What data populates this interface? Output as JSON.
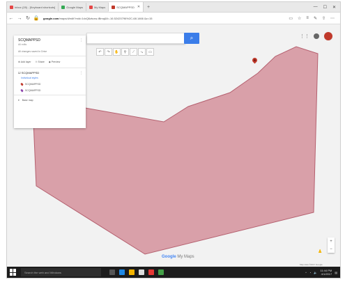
{
  "browser": {
    "tabs": [
      {
        "label": "Inbox (28) - [Keyboard shortcuts]",
        "color": "#e54646",
        "active": false
      },
      {
        "label": "Google Maps",
        "color": "#34a853",
        "active": false
      },
      {
        "label": "My Maps",
        "color": "#e54646",
        "active": false
      },
      {
        "label": "SCQMAPPSD",
        "color": "#c0392b",
        "active": true
      }
    ],
    "url_domain": "google.com",
    "url_rest": "/maps/d/edit?mid=1dxQ6ztuxw-tBmq&ll=-16.52420796%2C-68.1466 &z=15"
  },
  "map": {
    "polygon_color": "#d9a0a9",
    "polygon_stroke": "#b5606f",
    "accent": "#3b7de9",
    "search_placeholder": "",
    "logo_g": "Google",
    "logo_rest": " My Maps",
    "attribution": "Map data ©2017 Google",
    "zoom_in": "+",
    "zoom_out": "−"
  },
  "panel": {
    "title": "SCQMAPPSD",
    "subtitle": "All edits",
    "note": "All changes saved in Drive",
    "actions": [
      "Add layer",
      "Share",
      "Preview"
    ],
    "layer_title": "SCQMAPPSD",
    "layer_link": "Individual styles",
    "features": [
      "SCQMAPPSD",
      "SCQMAPPSD"
    ],
    "base_map": "Base map"
  },
  "taskbar": {
    "search_placeholder": "Search the web and Windows",
    "time": "11:44 PM",
    "date": "4/1/2017"
  }
}
